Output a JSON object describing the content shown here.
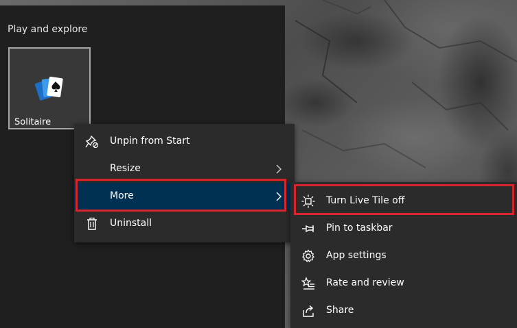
{
  "start": {
    "group_title": "Play and explore",
    "tile": {
      "label": "Solitaire",
      "icon": "solitaire-cards-icon"
    }
  },
  "context_menu": {
    "items": [
      {
        "label": "Unpin from Start",
        "icon": "unpin-icon",
        "has_submenu": false
      },
      {
        "label": "Resize",
        "icon": "",
        "has_submenu": true
      },
      {
        "label": "More",
        "icon": "",
        "has_submenu": true,
        "highlighted": true
      },
      {
        "label": "Uninstall",
        "icon": "trash-icon",
        "has_submenu": false
      }
    ]
  },
  "more_submenu": {
    "items": [
      {
        "label": "Turn Live Tile off",
        "icon": "live-tile-icon",
        "highlighted": true
      },
      {
        "label": "Pin to taskbar",
        "icon": "pin-icon"
      },
      {
        "label": "App settings",
        "icon": "gear-icon"
      },
      {
        "label": "Rate and review",
        "icon": "star-list-icon"
      },
      {
        "label": "Share",
        "icon": "share-icon"
      }
    ]
  },
  "colors": {
    "highlight": "#003152",
    "annotation_frame": "#d9242b",
    "menu_background": "#2b2b2b"
  }
}
